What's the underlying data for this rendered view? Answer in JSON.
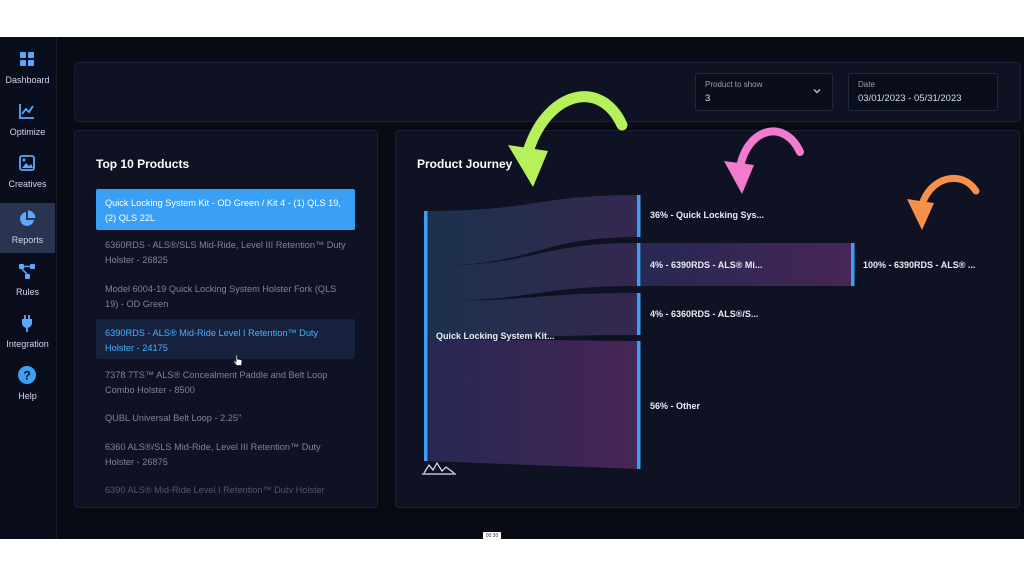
{
  "sidebar": {
    "items": [
      {
        "label": "Dashboard",
        "icon": "dashboard-icon"
      },
      {
        "label": "Optimize",
        "icon": "chart-line-icon"
      },
      {
        "label": "Creatives",
        "icon": "image-icon"
      },
      {
        "label": "Reports",
        "icon": "pie-chart-icon",
        "active": true
      },
      {
        "label": "Rules",
        "icon": "network-icon"
      },
      {
        "label": "Integration",
        "icon": "plug-icon"
      },
      {
        "label": "Help",
        "icon": "help-circle-icon"
      }
    ]
  },
  "filters": {
    "product_label": "Product to show",
    "product_value": "3",
    "date_label": "Date",
    "date_value": "03/01/2023 - 05/31/2023"
  },
  "top_products": {
    "title": "Top 10 Products",
    "items": [
      "Quick Locking System Kit - OD Green / Kit 4 - (1) QLS 19, (2) QLS 22L",
      "6360RDS - ALS®/SLS Mid-Ride, Level III Retention™ Duty Holster - 26825",
      "Model 6004-19 Quick Locking System Holster Fork (QLS 19) - OD Green",
      "6390RDS - ALS® Mid-Ride Level I Retention™ Duty Holster - 24175",
      "7378 7TS™ ALS® Concealment Paddle and Belt Loop Combo Holster - 8500",
      "QUBL Universal Belt Loop - 2.25\"",
      "6360 ALS®/SLS Mid-Ride, Level III Retention™ Duty Holster - 26875",
      "6390 ALS® Mid-Ride Level I Retention™ Duty Holster"
    ]
  },
  "journey": {
    "title": "Product Journey",
    "source_label": "Quick Locking System Kit...",
    "nodes": [
      {
        "label": "36% - Quick Locking Sys...",
        "pct": 36
      },
      {
        "label": "4% - 6390RDS - ALS® Mi...",
        "pct": 4
      },
      {
        "label": "4% - 6360RDS - ALS®/S...",
        "pct": 4
      },
      {
        "label": "56% - Other",
        "pct": 56
      }
    ],
    "final_node": {
      "label": "100% - 6390RDS - ALS® ...",
      "pct": 100
    }
  },
  "colors": {
    "accent": "#3aa0f5",
    "arrow_green": "#b6f05a",
    "arrow_pink": "#f27bd0",
    "arrow_orange": "#f5914a"
  },
  "video_time": "00:30"
}
